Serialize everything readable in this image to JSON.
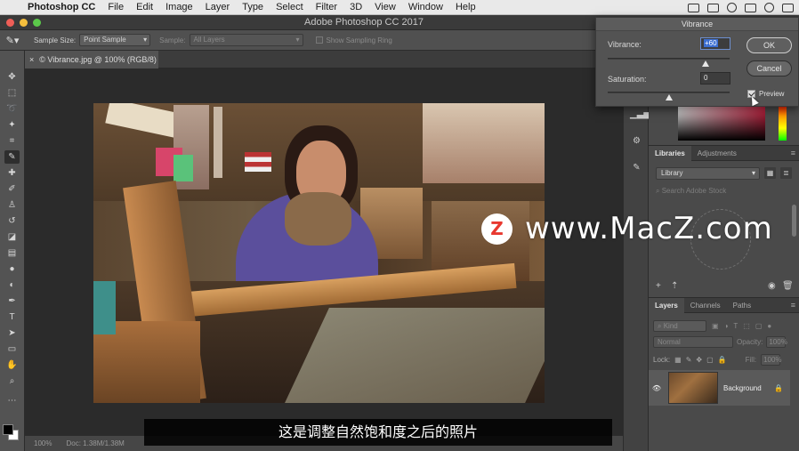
{
  "menubar": {
    "app": "Photoshop CC",
    "items": [
      "File",
      "Edit",
      "Image",
      "Layer",
      "Type",
      "Select",
      "Filter",
      "3D",
      "View",
      "Window",
      "Help"
    ]
  },
  "titlebar": {
    "title": "Adobe Photoshop CC 2017"
  },
  "options": {
    "sample_size_label": "Sample Size:",
    "sample_size_value": "Point Sample",
    "sample_label": "Sample:",
    "sample_value": "All Layers",
    "sampling_ring_label": "Show Sampling Ring"
  },
  "document": {
    "tab_label": "© Vibrance.jpg @ 100% (RGB/8)",
    "close_glyph": "×",
    "zoom": "100%",
    "doc_size": "Doc: 1.38M/1.38M"
  },
  "vibrance_dialog": {
    "title": "Vibrance",
    "vibrance_label": "Vibrance:",
    "vibrance_value": "+60",
    "vibrance_level": 60,
    "saturation_label": "Saturation:",
    "saturation_value": "0",
    "saturation_level": 0,
    "ok_label": "OK",
    "cancel_label": "Cancel",
    "preview_label": "Preview",
    "preview_checked": true
  },
  "libraries_panel": {
    "tabs": [
      "Libraries",
      "Adjustments"
    ],
    "active_tab": "Libraries",
    "library_select": "Library",
    "search_placeholder": "Search Adobe Stock"
  },
  "layers_panel": {
    "tabs": [
      "Layers",
      "Channels",
      "Paths"
    ],
    "active_tab": "Layers",
    "filter_kind": "Kind",
    "blend_mode": "Normal",
    "opacity_label": "Opacity:",
    "opacity_value": "100%",
    "lock_label": "Lock:",
    "fill_label": "Fill:",
    "fill_value": "100%",
    "layer_name": "Background"
  },
  "watermark": {
    "logo_letter": "Z",
    "text": "www.MacZ.com"
  },
  "subtitle": "这是调整自然饱和度之后的照片",
  "colors": {
    "accent": "#3b6ed1",
    "menubar": "#e9e9e9",
    "panel": "#535353"
  }
}
